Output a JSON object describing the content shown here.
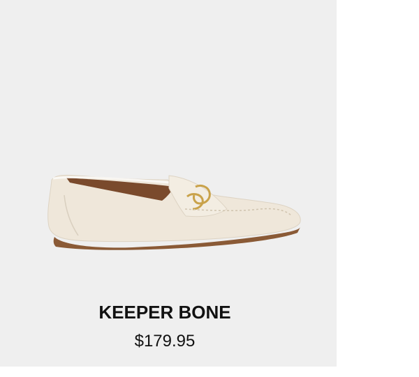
{
  "product": {
    "name": "KEEPER BONE",
    "price": "$179.95",
    "image_subject": "loafer-shoe"
  },
  "colors": {
    "card_background": "#efefef",
    "page_background": "#ffffff",
    "shoe_leather": "#efe7da",
    "sole": "#8a5a36",
    "hardware": "#c9a24a",
    "text": "#111111"
  }
}
